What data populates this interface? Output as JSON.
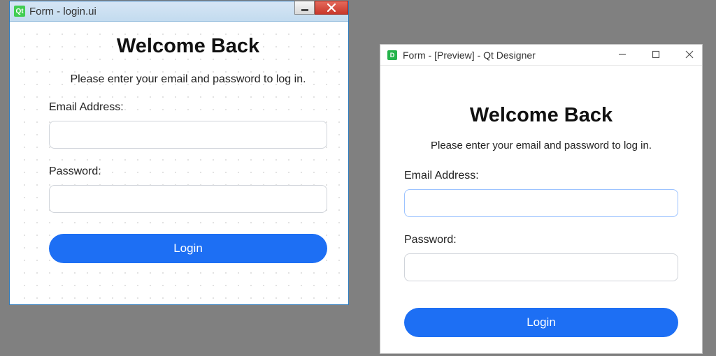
{
  "designer_window": {
    "title": "Form - login.ui",
    "icon_text": "Qt"
  },
  "preview_window": {
    "title": "Form - [Preview] - Qt Designer",
    "icon_text": "D"
  },
  "form": {
    "heading": "Welcome Back",
    "subtext": "Please enter your email and password to log in.",
    "email_label": "Email Address:",
    "password_label": "Password:",
    "email_value": "",
    "password_value": "",
    "login_label": "Login"
  }
}
